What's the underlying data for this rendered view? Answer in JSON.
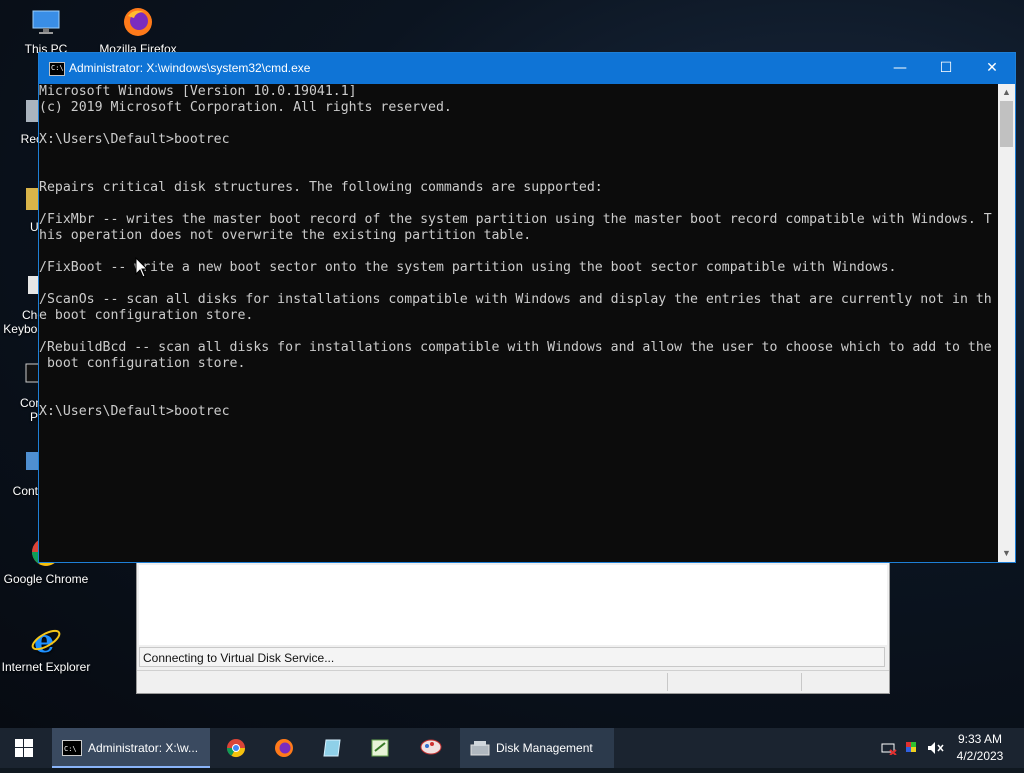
{
  "desktop": {
    "icons": [
      {
        "label": "This PC",
        "icon": "this-pc-icon"
      },
      {
        "label": "Mozilla Firefox",
        "icon": "firefox-icon"
      },
      {
        "label": "Rec",
        "icon": "recycle-bin-icon"
      },
      {
        "label": "Ut",
        "icon": "utility-icon"
      },
      {
        "label": "Che\nKeyboa",
        "icon": "keyboard-check-icon"
      },
      {
        "label": "Con\nPr",
        "icon": "command-prompt-icon"
      },
      {
        "label": "Contr",
        "icon": "control-panel-icon"
      },
      {
        "label": "Google Chrome",
        "icon": "chrome-icon"
      },
      {
        "label": "Internet Explorer",
        "icon": "internet-explorer-icon"
      }
    ]
  },
  "disk_management": {
    "status_text": "Connecting to Virtual Disk Service..."
  },
  "cmd": {
    "title": "Administrator: X:\\windows\\system32\\cmd.exe",
    "minimize": "—",
    "maximize": "☐",
    "close": "✕",
    "lines": [
      "Microsoft Windows [Version 10.0.19041.1]",
      "(c) 2019 Microsoft Corporation. All rights reserved.",
      "",
      "X:\\Users\\Default>bootrec",
      "",
      "",
      "Repairs critical disk structures. The following commands are supported:",
      "",
      "/FixMbr -- writes the master boot record of the system partition using the master boot record compatible with Windows. T",
      "his operation does not overwrite the existing partition table.",
      "",
      "/FixBoot -- write a new boot sector onto the system partition using the boot sector compatible with Windows.",
      "",
      "/ScanOs -- scan all disks for installations compatible with Windows and display the entries that are currently not in th",
      "e boot configuration store.",
      "",
      "/RebuildBcd -- scan all disks for installations compatible with Windows and allow the user to choose which to add to the",
      " boot configuration store.",
      "",
      "",
      "X:\\Users\\Default>bootrec"
    ]
  },
  "taskbar": {
    "cmd_label": "Administrator: X:\\w...",
    "disk_label": "Disk Management",
    "time": "9:33 AM",
    "date": "4/2/2023"
  },
  "colors": {
    "titlebar": "#0f74d6",
    "console_bg": "#0c0c0c",
    "console_fg": "#cccccc",
    "taskbar": "#1b2430"
  }
}
